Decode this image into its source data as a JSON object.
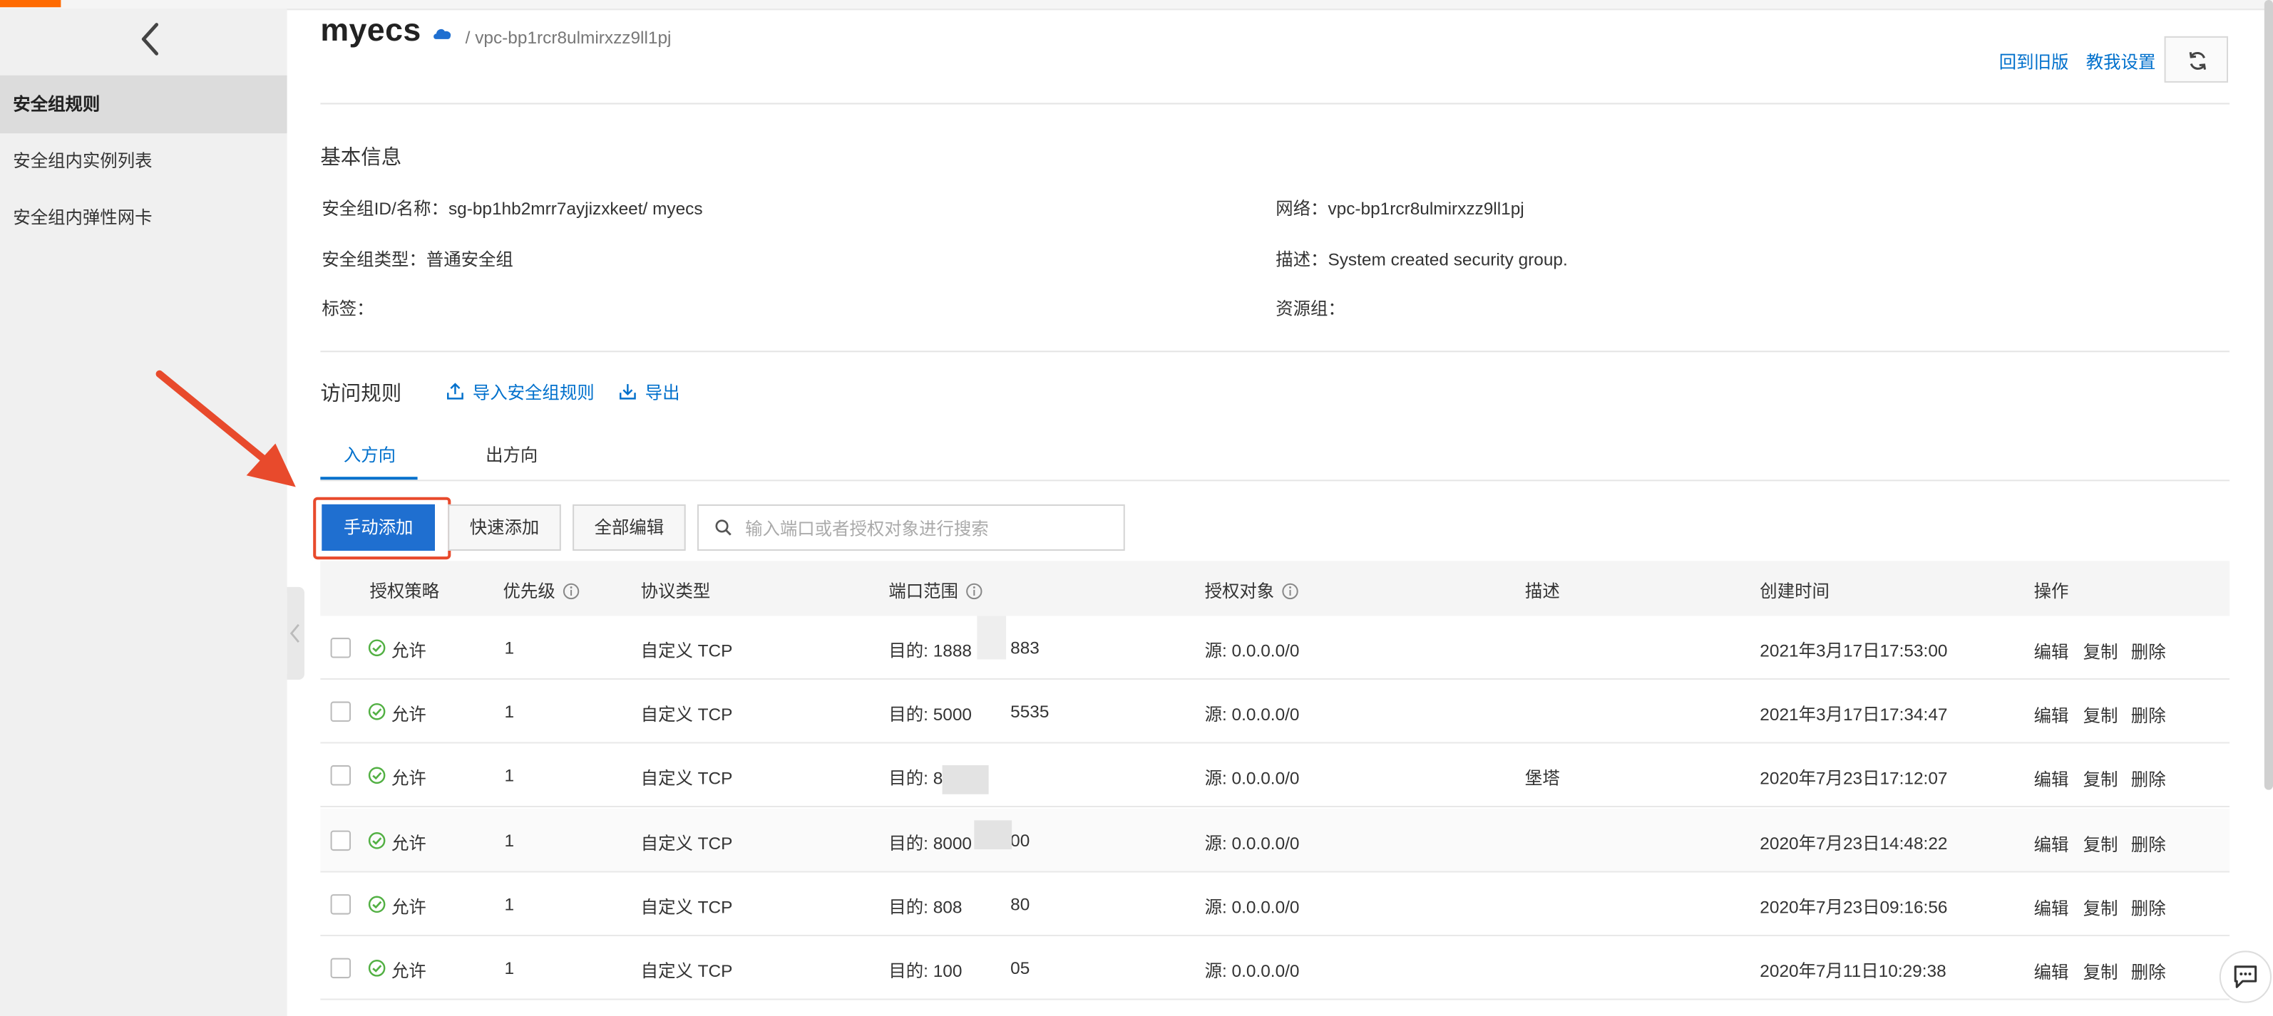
{
  "sidebar": {
    "items": [
      {
        "label": "安全组规则",
        "active": true
      },
      {
        "label": "安全组内实例列表",
        "active": false
      },
      {
        "label": "安全组内弹性网卡",
        "active": false
      }
    ]
  },
  "header": {
    "title": "myecs",
    "breadcrumb": "/ vpc-bp1rcr8ulmirxzz9ll1pj",
    "old_version_link": "回到旧版",
    "teach_me_link": "教我设置"
  },
  "basic_info": {
    "heading": "基本信息",
    "sg_id_label": "安全组ID/名称：",
    "sg_id_value": "sg-bp1hb2mrr7ayjizxkeet/ myecs",
    "network_label": "网络：",
    "network_value": "vpc-bp1rcr8ulmirxzz9ll1pj",
    "type_label": "安全组类型：",
    "type_value": "普通安全组",
    "desc_label": "描述：",
    "desc_value": "System created security group.",
    "tag_label": "标签：",
    "resource_group_label": "资源组："
  },
  "rules": {
    "heading": "访问规则",
    "import_link": "导入安全组规则",
    "export_link": "导出",
    "tabs": [
      {
        "label": "入方向",
        "active": true
      },
      {
        "label": "出方向",
        "active": false
      }
    ],
    "manual_add_button": "手动添加",
    "quick_add_button": "快速添加",
    "edit_all_button": "全部编辑",
    "search_placeholder": "输入端口或者授权对象进行搜索",
    "columns": {
      "policy": "授权策略",
      "priority": "优先级",
      "protocol": "协议类型",
      "port": "端口范围",
      "source": "授权对象",
      "description": "描述",
      "created": "创建时间",
      "actions": "操作"
    },
    "action_edit": "编辑",
    "action_copy": "复制",
    "action_delete": "删除",
    "rows": [
      {
        "policy": "允许",
        "priority": "1",
        "protocol": "自定义 TCP",
        "port_a": "目的: 1888",
        "port_b": "883",
        "source": "源: 0.0.0.0/0",
        "description": "",
        "created": "2021年3月17日17:53:00"
      },
      {
        "policy": "允许",
        "priority": "1",
        "protocol": "自定义 TCP",
        "port_a": "目的: 5000",
        "port_b": "5535",
        "source": "源: 0.0.0.0/0",
        "description": "",
        "created": "2021年3月17日17:34:47"
      },
      {
        "policy": "允许",
        "priority": "1",
        "protocol": "自定义 TCP",
        "port_a": "目的: 8",
        "port_b": "",
        "source": "源: 0.0.0.0/0",
        "description": "堡塔",
        "created": "2020年7月23日17:12:07"
      },
      {
        "policy": "允许",
        "priority": "1",
        "protocol": "自定义 TCP",
        "port_a": "目的: 8000",
        "port_b": "00",
        "source": "源: 0.0.0.0/0",
        "description": "",
        "created": "2020年7月23日14:48:22"
      },
      {
        "policy": "允许",
        "priority": "1",
        "protocol": "自定义 TCP",
        "port_a": "目的: 808",
        "port_b": "80",
        "source": "源: 0.0.0.0/0",
        "description": "",
        "created": "2020年7月23日09:16:56"
      },
      {
        "policy": "允许",
        "priority": "1",
        "protocol": "自定义 TCP",
        "port_a": "目的: 100",
        "port_b": "05",
        "source": "源: 0.0.0.0/0",
        "description": "",
        "created": "2020年7月11日10:29:38"
      }
    ]
  },
  "colors": {
    "primary": "#1f6fd0",
    "link": "#0070cc",
    "allow_green": "#52b043",
    "annotation_red": "#e84a2c",
    "brand_orange": "#ff6a00"
  }
}
